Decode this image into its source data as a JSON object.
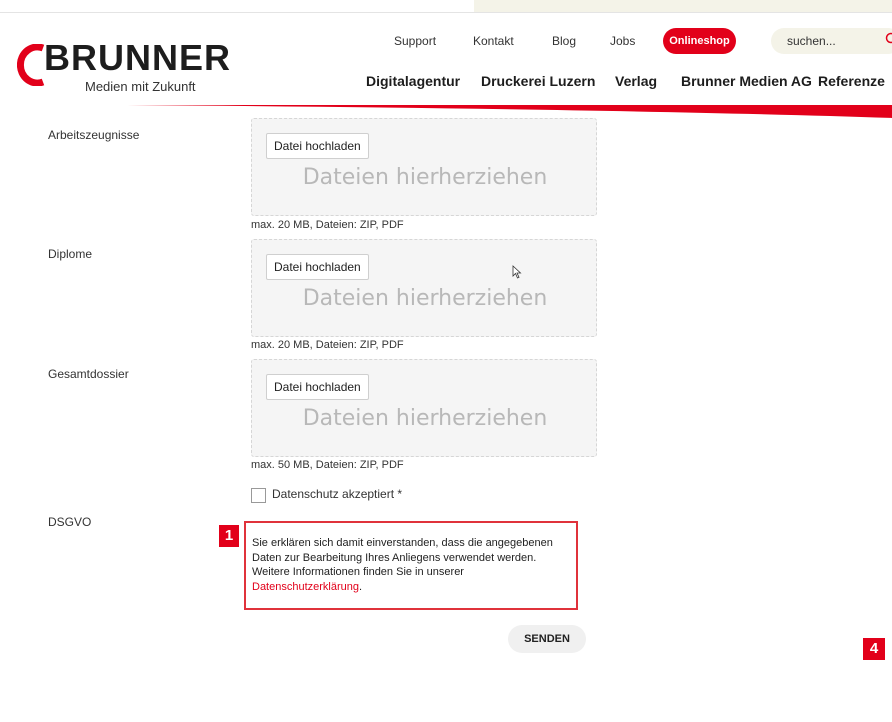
{
  "header": {
    "logo_text": "BRUNNER",
    "logo_tagline": "Medien mit Zukunft",
    "top_links": [
      "Support",
      "Kontakt",
      "Blog",
      "Jobs"
    ],
    "shop_label": "Onlineshop",
    "search_placeholder": "suchen...",
    "main_nav": [
      "Digitalagentur",
      "Druckerei Luzern",
      "Verlag",
      "Brunner Medien AG",
      "Referenze"
    ]
  },
  "form": {
    "fields": [
      {
        "label": "Arbeitszeugnisse",
        "button": "Datei hochladen",
        "drop_text": "Dateien hierherziehen",
        "hint": "max. 20 MB, Dateien: ZIP, PDF"
      },
      {
        "label": "Diplome",
        "button": "Datei hochladen",
        "drop_text": "Dateien hierherziehen",
        "hint": "max. 20 MB, Dateien: ZIP, PDF"
      },
      {
        "label": "Gesamtdossier",
        "button": "Datei hochladen",
        "drop_text": "Dateien hierherziehen",
        "hint": "max. 50 MB, Dateien: ZIP, PDF"
      }
    ],
    "checkbox_label": "Datenschutz akzeptiert *",
    "dsgvo_label": "DSGVO",
    "consent_text": "Sie erklären sich damit einverstanden, dass die angegebenen Daten zur Bearbeitung Ihres Anliegens verwendet werden. Weitere Informationen finden Sie in unserer",
    "consent_link": "Datenschutzerklärung",
    "consent_end": ".",
    "submit_label": "SENDEN"
  },
  "markers": [
    "1",
    "4"
  ],
  "colors": {
    "brand_red": "#e2001a",
    "search_bg": "#f4f3e8",
    "dropzone_bg": "#f5f5f5"
  }
}
